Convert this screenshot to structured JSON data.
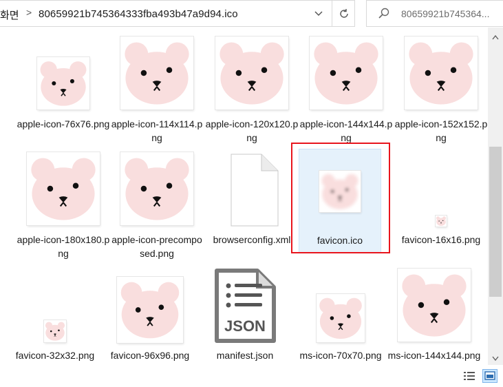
{
  "address": {
    "root": "화면",
    "separator": ">",
    "folder": "80659921b745364333fba493b47a9d94.ico"
  },
  "search": {
    "text": "80659921b745364..."
  },
  "files": [
    {
      "label": "apple-icon-76x76.png",
      "icon": "bear-thumbnail"
    },
    {
      "label": "apple-icon-114x114.png",
      "icon": "bear-thumbnail"
    },
    {
      "label": "apple-icon-120x120.png",
      "icon": "bear-thumbnail"
    },
    {
      "label": "apple-icon-144x144.png",
      "icon": "bear-thumbnail"
    },
    {
      "label": "apple-icon-152x152.png",
      "icon": "bear-thumbnail"
    },
    {
      "label": "apple-icon-180x180.png",
      "icon": "bear-thumbnail"
    },
    {
      "label": "apple-icon-precomposed.png",
      "icon": "bear-thumbnail"
    },
    {
      "label": "browserconfig.xml",
      "icon": "generic-file-icon"
    },
    {
      "label": "favicon.ico",
      "icon": "bear-thumbnail-blurred"
    },
    {
      "label": "favicon-16x16.png",
      "icon": "bear-thumbnail"
    },
    {
      "label": "favicon-32x32.png",
      "icon": "bear-thumbnail"
    },
    {
      "label": "favicon-96x96.png",
      "icon": "bear-thumbnail"
    },
    {
      "label": "manifest.json",
      "icon": "json-file-icon",
      "icon_text": "JSON"
    },
    {
      "label": "ms-icon-70x70.png",
      "icon": "bear-thumbnail"
    },
    {
      "label": "ms-icon-144x144.png",
      "icon": "bear-thumbnail"
    }
  ],
  "selected": "favicon.ico",
  "colors": {
    "selection_bg": "#e5f1fb",
    "highlight_border": "#e8141c",
    "bear_pink": "#f9dede"
  }
}
